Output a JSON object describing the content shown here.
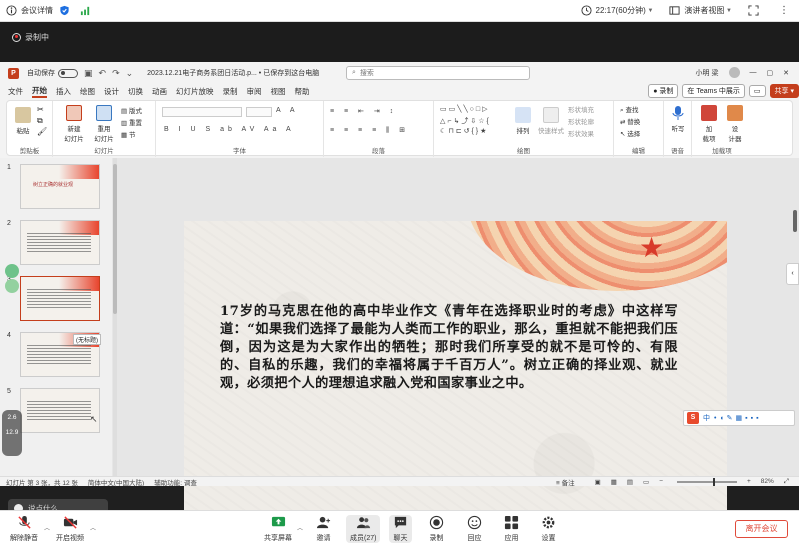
{
  "meeting_top": {
    "details_label": "会议详情",
    "time_label": "22:17(60分钟)",
    "view_label": "演讲者视图"
  },
  "recording": {
    "label": "录制中"
  },
  "ppt": {
    "autosave_label": "自动保存",
    "toggle_state": "关",
    "filename": "2023.12.21电子商务系团日活动.p... • 已保存到这台电脑",
    "search_placeholder": "搜索",
    "user_name": "小明 梁",
    "menu_tabs": [
      "文件",
      "开始",
      "插入",
      "绘图",
      "设计",
      "切换",
      "动画",
      "幻灯片放映",
      "录制",
      "审阅",
      "视图",
      "帮助"
    ],
    "active_tab": "开始",
    "record_btn": "录制",
    "teams_btn": "在 Teams 中展示",
    "share_btn": "共享",
    "ribbon": {
      "paste": "粘贴",
      "new_slide": "新建\n幻灯片",
      "reuse": "重用\n幻灯片",
      "layout": "版式",
      "reset": "重置",
      "section": "节",
      "arrange": "排列",
      "quick_style": "快速样式",
      "shape_fill": "形状填充",
      "shape_outline": "形状轮廓",
      "shape_effects": "形状效果",
      "find": "查找",
      "replace": "替换",
      "select": "选择",
      "dictate": "听写",
      "addins": "加\n载项",
      "designer": "设\n计器",
      "groups": {
        "clipboard": "剪贴板",
        "slides": "幻灯片",
        "font": "字体",
        "paragraph": "段落",
        "drawing": "绘图",
        "editing": "编辑",
        "voice": "语音",
        "addins_group": "加载项"
      }
    },
    "thumbnails": {
      "numbers": [
        "1",
        "2",
        "3",
        "4",
        "5"
      ],
      "slide1_title": "树立正确的就业观",
      "drop_tip": "(无标题)"
    },
    "slide_text": "17岁的马克思在他的高中毕业作文《青年在选择职业时的考虑》中这样写道：“如果我们选择了最能为人类而工作的职业，那么，重担就不能把我们压倒，因为这是为大家作出的牺牲；那时我们所享受的就不是可怜的、有限的、自私的乐趣，我们的幸福将属于千百万人”。树立正确的择业观、就业观，必须把个人的理想追求融入党和国家事业之中。",
    "side_values": [
      "2.6",
      "12.9"
    ],
    "float_say": "说点什么...",
    "ime": {
      "letter": "S",
      "lang": "中"
    },
    "status": {
      "slide_info": "幻灯片 第 3 张，共 12 张",
      "language": "简体中文(中国大陆)",
      "accessibility": "辅助功能: 调查",
      "notes": "备注",
      "zoom": "82%"
    }
  },
  "meet_bottom": {
    "unmute": "解除静音",
    "start_video": "开启视频",
    "share_screen": "共享屏幕",
    "invite": "邀请",
    "members": "成员(27)",
    "chat": "聊天",
    "record": "录制",
    "react": "回应",
    "apps": "应用",
    "settings": "设置",
    "leave": "离开会议"
  },
  "colors": {
    "accent": "#c43e1c",
    "leave_red": "#e04a3a",
    "slide_star": "#d83a2a"
  }
}
